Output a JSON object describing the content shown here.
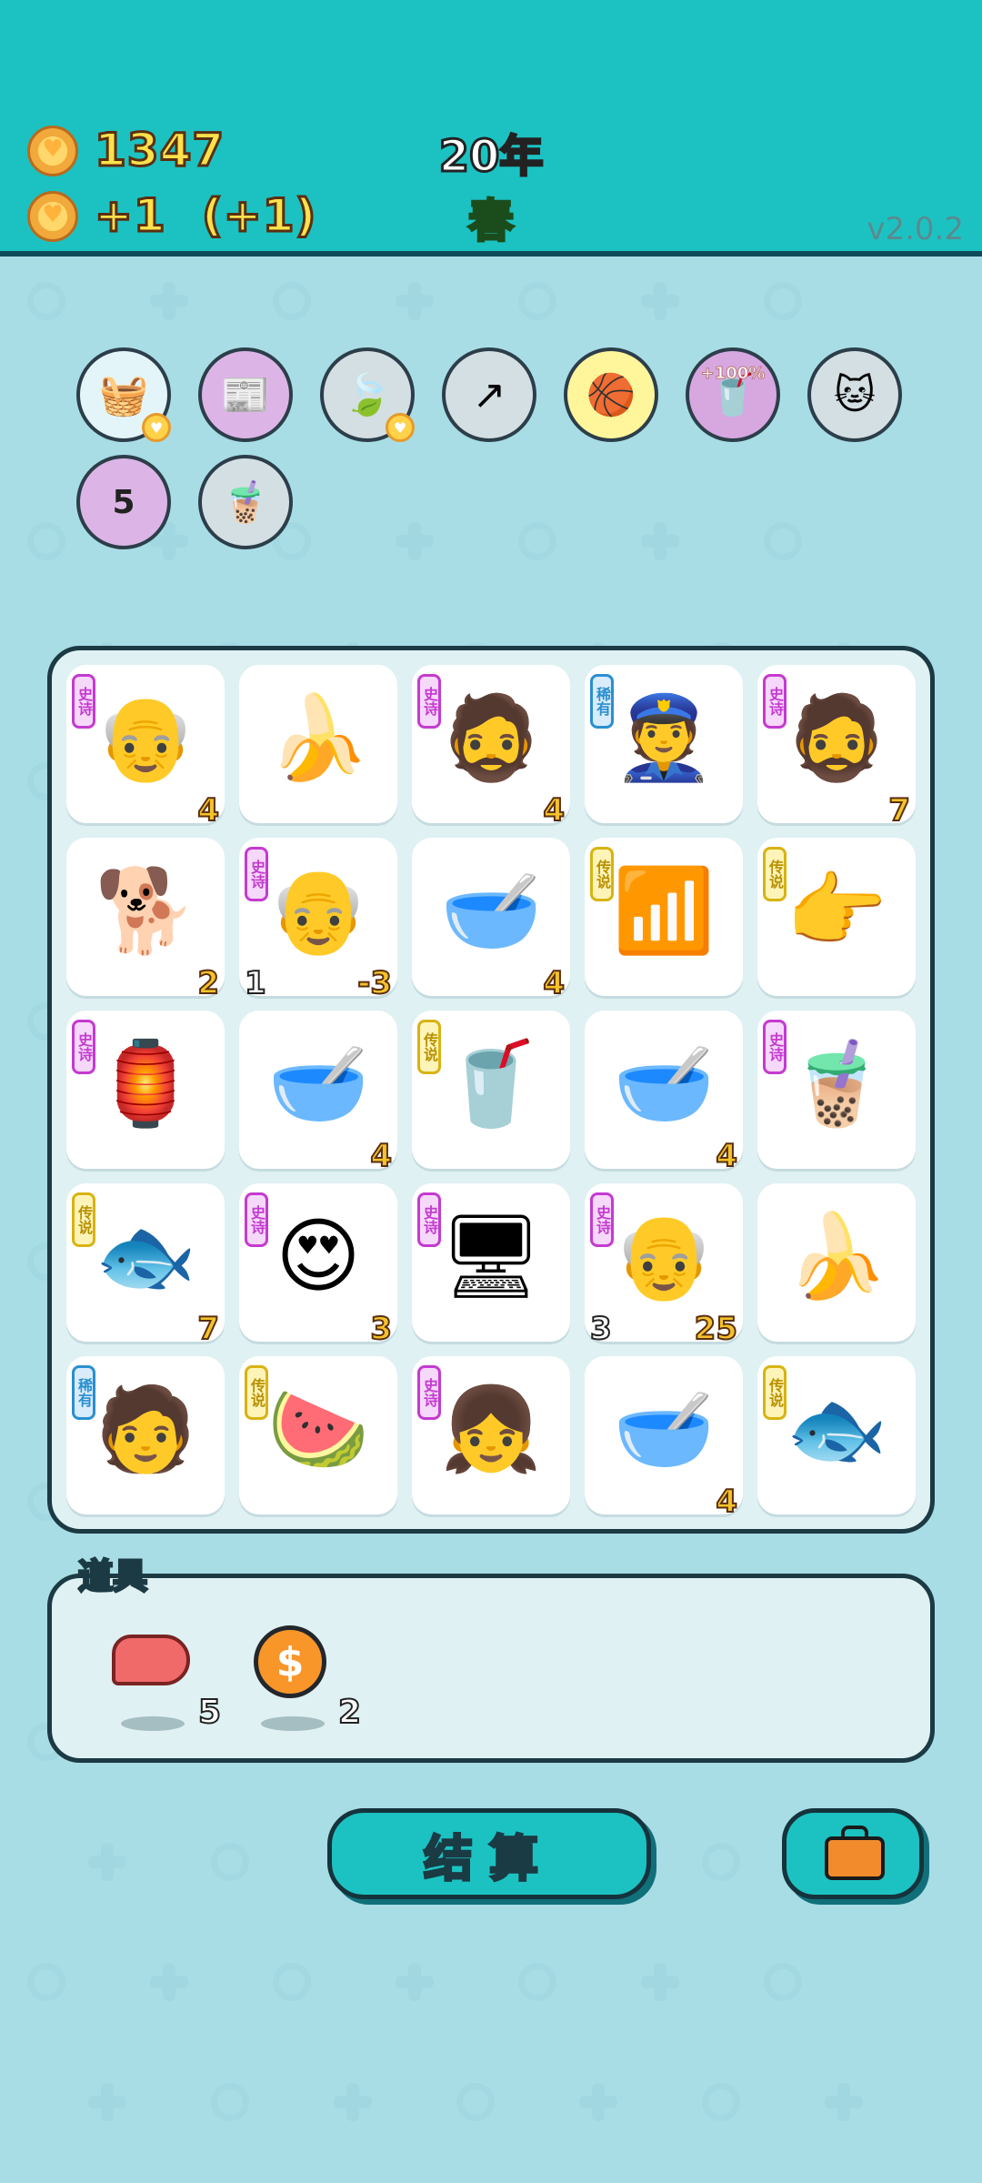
{
  "hud": {
    "coins": "1347",
    "income": "+1",
    "income_bonus": "(+1)",
    "year": "20年",
    "season": "春",
    "version": "v2.0.2"
  },
  "buffs": [
    {
      "name": "fruit-basket-icon",
      "emoji": "🧺",
      "bg": "#e4f5f9",
      "mini": true
    },
    {
      "name": "time-magazine-icon",
      "emoji": "📰",
      "bg": "#dcb5e6",
      "mini": false
    },
    {
      "name": "leaf-icon",
      "emoji": "🍃",
      "bg": "#d3dfe2",
      "mini": true
    },
    {
      "name": "up-arrow-card-icon",
      "emoji": "↗",
      "bg": "#d3dfe2",
      "mini": false
    },
    {
      "name": "basketballs-icon",
      "emoji": "🏀",
      "bg": "#fff59a",
      "mini": false
    },
    {
      "name": "milk-tea-boost-icon",
      "emoji": "🥤",
      "bg": "#d7a7e0",
      "mini": false,
      "pct": "+100%"
    },
    {
      "name": "cats-icon",
      "emoji": "🐱",
      "bg": "#d3dfe2",
      "mini": false
    },
    {
      "name": "calendar-icon",
      "emoji": "",
      "bg": "#dcb5e6",
      "mini": false,
      "cal": "5"
    },
    {
      "name": "milk-tea-cup-icon",
      "emoji": "🧋",
      "bg": "#d3dfe2",
      "mini": false
    }
  ],
  "tags": {
    "epic": "史诗",
    "rare": "稀有",
    "legend": "传说"
  },
  "tiles": [
    {
      "name": "old-man-icon",
      "emoji": "👴",
      "tag": "epic",
      "br": "4",
      "bl": ""
    },
    {
      "name": "banana-icon",
      "emoji": "🍌",
      "tag": "",
      "br": "",
      "bl": ""
    },
    {
      "name": "green-hat-man-icon",
      "emoji": "🧔",
      "tag": "epic",
      "br": "4",
      "bl": ""
    },
    {
      "name": "police-officer-icon",
      "emoji": "👮",
      "tag": "rare",
      "br": "",
      "bl": ""
    },
    {
      "name": "green-hat-man-icon",
      "emoji": "🧔",
      "tag": "epic",
      "br": "7",
      "bl": ""
    },
    {
      "name": "husky-dog-icon",
      "emoji": "🐕",
      "tag": "",
      "br": "2",
      "bl": ""
    },
    {
      "name": "grandpa-glasses-icon",
      "emoji": "👴",
      "tag": "epic",
      "br": "-3",
      "bl": "1"
    },
    {
      "name": "soup-bowl-icon",
      "emoji": "🥣",
      "tag": "",
      "br": "4",
      "bl": ""
    },
    {
      "name": "wifi-icon",
      "emoji": "📶",
      "tag": "legend",
      "br": "",
      "bl": ""
    },
    {
      "name": "pointing-hand-icon",
      "emoji": "👉",
      "tag": "legend",
      "br": "",
      "bl": ""
    },
    {
      "name": "rabbit-house-icon",
      "emoji": "🏮",
      "tag": "epic",
      "br": "",
      "bl": ""
    },
    {
      "name": "soup-bowl-icon",
      "emoji": "🥣",
      "tag": "",
      "br": "4",
      "bl": ""
    },
    {
      "name": "milk-tea-icon",
      "emoji": "🥤",
      "tag": "legend",
      "br": "",
      "bl": ""
    },
    {
      "name": "soup-bowl-icon",
      "emoji": "🥣",
      "tag": "",
      "br": "4",
      "bl": ""
    },
    {
      "name": "boba-tea-icon",
      "emoji": "🧋",
      "tag": "epic",
      "br": "",
      "bl": ""
    },
    {
      "name": "koi-fish-icon",
      "emoji": "🐟",
      "tag": "legend",
      "br": "7",
      "bl": ""
    },
    {
      "name": "heart-eyes-face-icon",
      "emoji": "😍",
      "tag": "epic",
      "br": "3",
      "bl": ""
    },
    {
      "name": "graphics-card-icon",
      "emoji": "🖥",
      "tag": "epic",
      "br": "",
      "bl": ""
    },
    {
      "name": "grandpa-glasses-icon",
      "emoji": "👴",
      "tag": "epic",
      "br": "25",
      "bl": "3"
    },
    {
      "name": "banana-icon",
      "emoji": "🍌",
      "tag": "",
      "br": "",
      "bl": ""
    },
    {
      "name": "bucket-hat-man-icon",
      "emoji": "🧑",
      "tag": "rare",
      "br": "",
      "bl": ""
    },
    {
      "name": "watermelon-icon",
      "emoji": "🍉",
      "tag": "legend",
      "br": "",
      "bl": ""
    },
    {
      "name": "heart-eyes-girl-icon",
      "emoji": "👧",
      "tag": "epic",
      "br": "",
      "bl": ""
    },
    {
      "name": "soup-bowl-icon",
      "emoji": "🥣",
      "tag": "",
      "br": "4",
      "bl": ""
    },
    {
      "name": "koi-fish-icon",
      "emoji": "🐟",
      "tag": "legend",
      "br": "",
      "bl": ""
    }
  ],
  "items": {
    "title": "道具",
    "list": [
      {
        "name": "liver-item",
        "icon": "liver-icon",
        "count": "5"
      },
      {
        "name": "coin-item",
        "icon": "dollar-coin-icon",
        "symbol": "$",
        "count": "2"
      }
    ]
  },
  "buttons": {
    "settle_label": "结算"
  }
}
